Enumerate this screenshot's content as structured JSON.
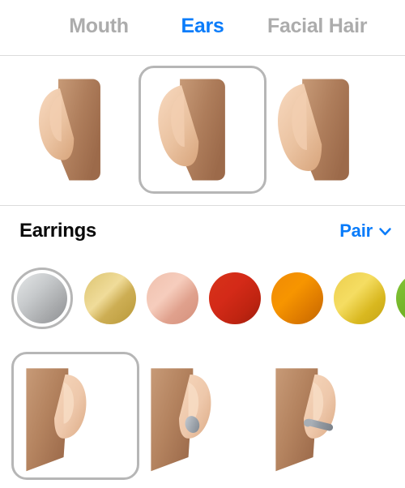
{
  "tabs": [
    {
      "label": "Mouth",
      "active": false
    },
    {
      "label": "Ears",
      "active": true
    },
    {
      "label": "Facial Hair",
      "active": false
    }
  ],
  "colors": {
    "accent": "#0a7cfa",
    "inactive_tab": "#acacac",
    "selection_border": "#b6b6b6",
    "divider": "#dcdcdc",
    "title": "#0a0a0a",
    "background": "#ffffff"
  },
  "ear_shapes": {
    "selected_index": 1,
    "items": [
      {
        "name": "ear-shape-1",
        "selected": false
      },
      {
        "name": "ear-shape-2",
        "selected": true
      },
      {
        "name": "ear-shape-3",
        "selected": false
      }
    ]
  },
  "earrings": {
    "title": "Earrings",
    "picker_value": "Pair",
    "picker_icon": "chevron-down-icon",
    "swatches": {
      "selected_index": 0,
      "items": [
        {
          "name": "silver",
          "hex": "#a9abad",
          "hex_light": "#e4e6e7",
          "selected": true
        },
        {
          "name": "gold",
          "hex": "#cdae54",
          "hex_light": "#f0dc9a",
          "selected": false
        },
        {
          "name": "rose-gold",
          "hex": "#e0a18d",
          "hex_light": "#f6cdbd",
          "selected": false
        },
        {
          "name": "red",
          "hex": "#bf2411",
          "hex_light": "#e0391f",
          "selected": false
        },
        {
          "name": "orange",
          "hex": "#d97400",
          "hex_light": "#f79500",
          "selected": false
        },
        {
          "name": "yellow",
          "hex": "#d9b820",
          "hex_light": "#f5dd62",
          "selected": false
        },
        {
          "name": "green",
          "hex": "#63ab1f",
          "hex_light": "#86c63a",
          "selected": false
        }
      ]
    },
    "styles": {
      "selected_index": 0,
      "items": [
        {
          "name": "earring-none",
          "selected": true
        },
        {
          "name": "earring-stud",
          "selected": false
        },
        {
          "name": "earring-bar",
          "selected": false
        }
      ]
    }
  },
  "skin": {
    "head_dark": "#9c6a4a",
    "head_light": "#c79a77",
    "ear_dark": "#dcab86",
    "ear_light": "#f6d6bb",
    "metal_dark": "#8b929a",
    "metal_light": "#c9ced4"
  }
}
